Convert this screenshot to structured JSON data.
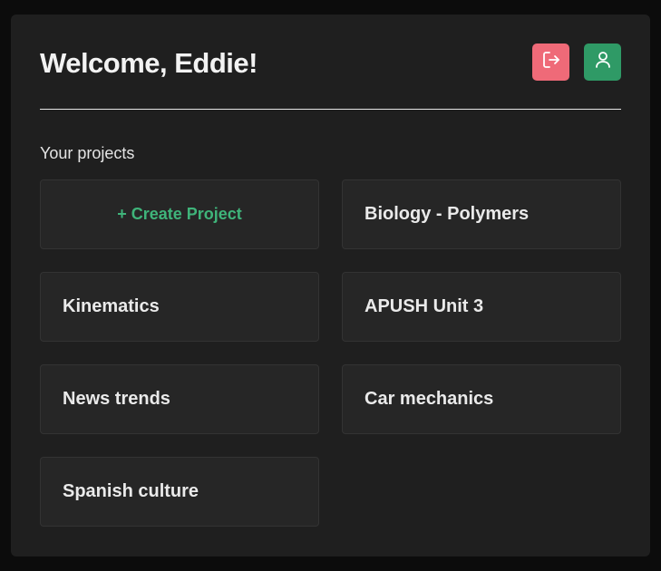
{
  "header": {
    "title": "Welcome, Eddie!"
  },
  "actions": {
    "logout_icon": "logout-icon",
    "profile_icon": "user-icon",
    "logout_color": "#ef6a78",
    "profile_color": "#2f9a66"
  },
  "projects": {
    "section_label": "Your projects",
    "create_label": "+ Create Project",
    "items": [
      {
        "name": "Biology - Polymers"
      },
      {
        "name": "Kinematics"
      },
      {
        "name": "APUSH Unit 3"
      },
      {
        "name": "News trends"
      },
      {
        "name": "Car mechanics"
      },
      {
        "name": "Spanish culture"
      }
    ]
  },
  "colors": {
    "background": "#0c0c0c",
    "panel": "#1f1f1f",
    "card": "#262626",
    "accent_green": "#3fb47a"
  }
}
